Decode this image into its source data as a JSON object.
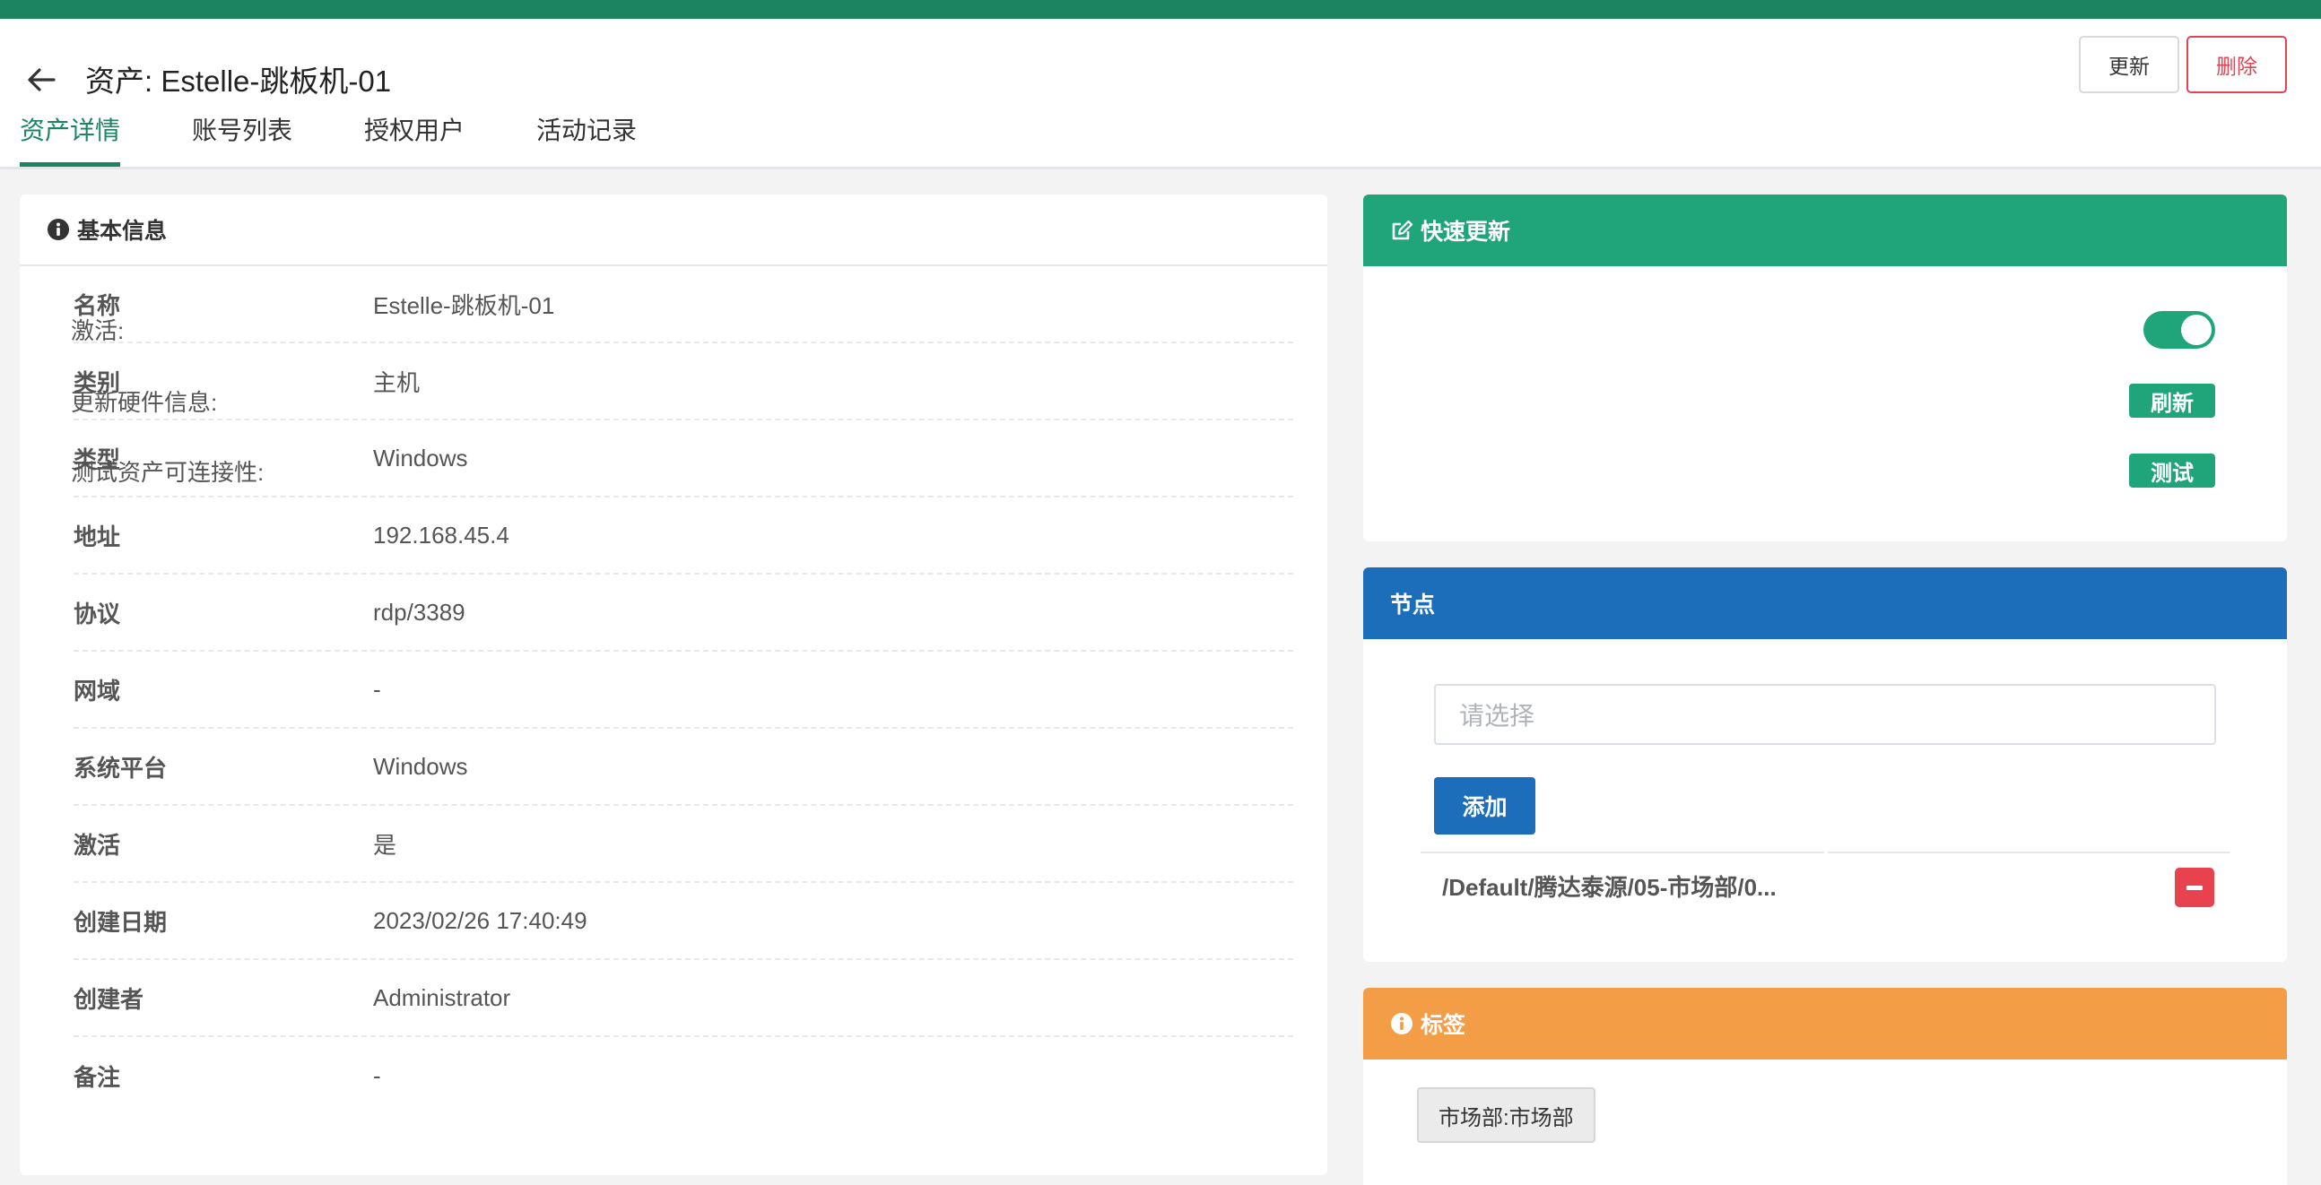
{
  "header": {
    "title": "资产: Estelle-跳板机-01",
    "update_label": "更新",
    "delete_label": "删除"
  },
  "tabs": [
    {
      "label": "资产详情",
      "active": true
    },
    {
      "label": "账号列表",
      "active": false
    },
    {
      "label": "授权用户",
      "active": false
    },
    {
      "label": "活动记录",
      "active": false
    }
  ],
  "basic_info": {
    "title": "基本信息",
    "rows": [
      {
        "label": "名称",
        "value": "Estelle-跳板机-01"
      },
      {
        "label": "类别",
        "value": "主机"
      },
      {
        "label": "类型",
        "value": "Windows"
      },
      {
        "label": "地址",
        "value": "192.168.45.4"
      },
      {
        "label": "协议",
        "value": "rdp/3389"
      },
      {
        "label": "网域",
        "value": "-"
      },
      {
        "label": "系统平台",
        "value": "Windows"
      },
      {
        "label": "激活",
        "value": "是"
      },
      {
        "label": "创建日期",
        "value": "2023/02/26 17:40:49"
      },
      {
        "label": "创建者",
        "value": "Administrator"
      },
      {
        "label": "备注",
        "value": "-"
      }
    ]
  },
  "quick_update": {
    "title": "快速更新",
    "active_label": "激活:",
    "active_on": true,
    "hardware_label": "更新硬件信息:",
    "hardware_button": "刷新",
    "test_label": "测试资产可连接性:",
    "test_button": "测试"
  },
  "nodes": {
    "title": "节点",
    "select_placeholder": "请选择",
    "add_button": "添加",
    "items": [
      {
        "path": "/Default/腾达泰源/05-市场部/0..."
      }
    ]
  },
  "tags": {
    "title": "标签",
    "items": [
      "市场部:市场部"
    ]
  },
  "colors": {
    "top_bar": "#1c8460",
    "quick_update_header": "#20a57b",
    "nodes_header": "#1c6eba",
    "tags_header": "#f49d47",
    "delete": "#e04455"
  }
}
